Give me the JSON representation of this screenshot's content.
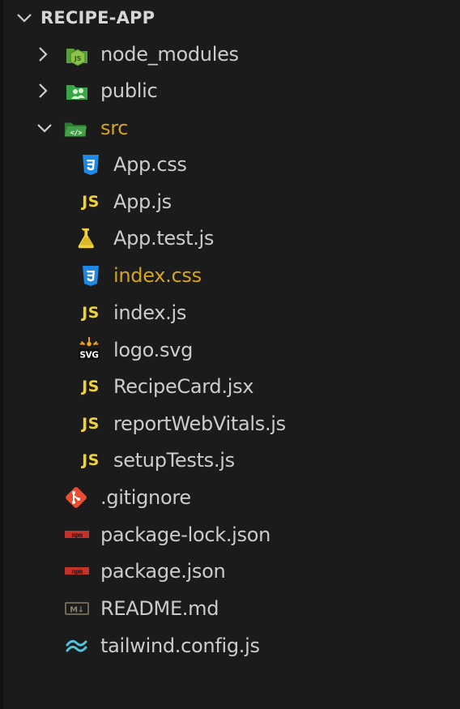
{
  "explorer": {
    "root": {
      "label": "RECIPE-APP",
      "expanded": true,
      "chevron_icon": "chevron-down-icon"
    },
    "items": [
      {
        "label": "node_modules",
        "type": "folder",
        "expanded": false,
        "icon": "folder-node-icon",
        "depth": 1
      },
      {
        "label": "public",
        "type": "folder",
        "expanded": false,
        "icon": "folder-public-icon",
        "depth": 1
      },
      {
        "label": "src",
        "type": "folder",
        "expanded": true,
        "icon": "folder-src-icon",
        "depth": 1,
        "modified": true
      },
      {
        "label": "App.css",
        "type": "file",
        "icon": "css-file-icon",
        "depth": 2
      },
      {
        "label": "App.js",
        "type": "file",
        "icon": "js-file-icon",
        "depth": 2
      },
      {
        "label": "App.test.js",
        "type": "file",
        "icon": "test-js-file-icon",
        "depth": 2
      },
      {
        "label": "index.css",
        "type": "file",
        "icon": "css-file-icon",
        "depth": 2,
        "modified": true
      },
      {
        "label": "index.js",
        "type": "file",
        "icon": "js-file-icon",
        "depth": 2
      },
      {
        "label": "logo.svg",
        "type": "file",
        "icon": "svg-file-icon",
        "depth": 2
      },
      {
        "label": "RecipeCard.jsx",
        "type": "file",
        "icon": "js-file-icon",
        "depth": 2
      },
      {
        "label": "reportWebVitals.js",
        "type": "file",
        "icon": "js-file-icon",
        "depth": 2
      },
      {
        "label": "setupTests.js",
        "type": "file",
        "icon": "js-file-icon",
        "depth": 2
      },
      {
        "label": ".gitignore",
        "type": "file",
        "icon": "git-icon",
        "depth": 1
      },
      {
        "label": "package-lock.json",
        "type": "file",
        "icon": "npm-icon",
        "depth": 1
      },
      {
        "label": "package.json",
        "type": "file",
        "icon": "npm-icon",
        "depth": 1
      },
      {
        "label": "README.md",
        "type": "file",
        "icon": "markdown-icon",
        "depth": 1
      },
      {
        "label": "tailwind.config.js",
        "type": "file",
        "icon": "tailwind-icon",
        "depth": 1
      }
    ],
    "js_badge_text": "JS",
    "svg_badge_text": "SVG",
    "npm_badge_text": "npm",
    "md_badge_text": "M↓",
    "colors": {
      "background": "#1b1b1b",
      "text": "#cccccc",
      "modified_text": "#d4a41c",
      "js_yellow": "#f0d33a",
      "css_blue": "#1e88e5",
      "folder_green": "#3aa64a",
      "git_red": "#e84d31",
      "npm_red": "#c3332b",
      "tailwind_teal": "#4fc3d9"
    }
  }
}
